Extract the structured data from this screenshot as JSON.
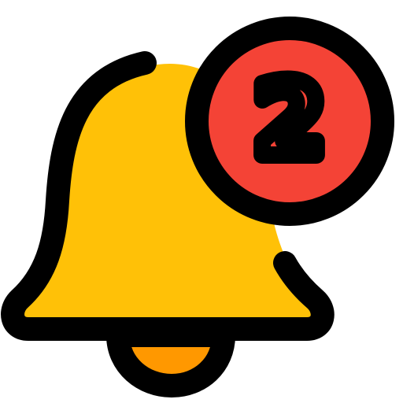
{
  "icon": {
    "name": "notification-bell-icon",
    "badge": {
      "count": "2",
      "fill": "#F44336",
      "outline": "#000000"
    },
    "bell": {
      "body_fill": "#FFC107",
      "clapper_fill": "#FF9800",
      "outline": "#000000"
    }
  }
}
